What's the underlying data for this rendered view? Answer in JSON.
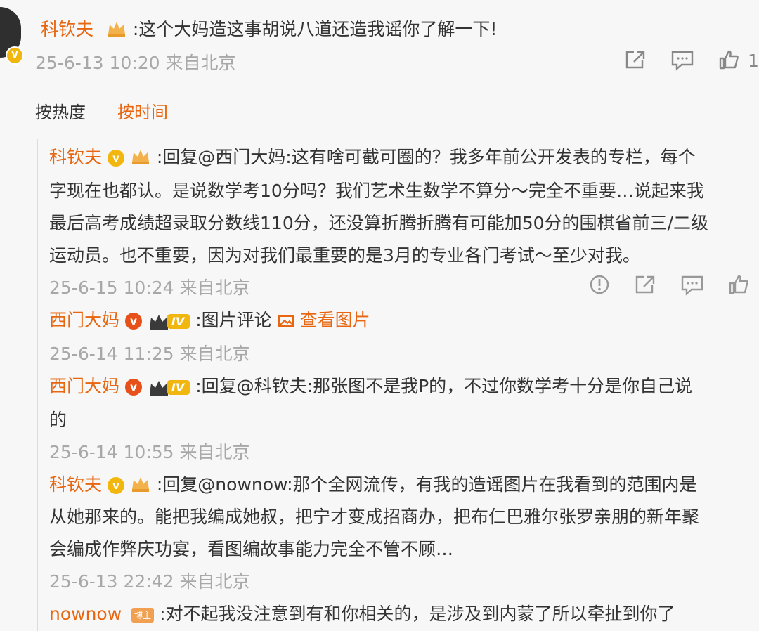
{
  "top_comment": {
    "user": "科钦夫",
    "text": ":这个大妈造这事胡说八道还造我谣你了解一下!",
    "time": "25-6-13 10:20 来自北京",
    "like_count": "1"
  },
  "sort_tabs": {
    "hot": "按热度",
    "time": "按时间"
  },
  "replies": [
    {
      "user": "科钦夫",
      "lines": [
        ":回复@西门大妈:这有啥可截可圈的？我多年前公开发表的专栏，每个",
        "字现在也都认。是说数学考10分吗？我们艺术生数学不算分～完全不重要…说起来我",
        "最后高考成绩超录取分数线110分，还没算折腾折腾有可能加50分的围棋省前三/二级",
        "运动员。也不重要，因为对我们最重要的是3月的专业各门考试～至少对我。"
      ],
      "time": "25-6-15 10:24 来自北京"
    },
    {
      "user": "西门大妈",
      "level": "IV",
      "text": ":图片评论",
      "link": "查看图片",
      "time": "25-6-14 11:25 来自北京"
    },
    {
      "user": "西门大妈",
      "level": "IV",
      "lines": [
        ":回复@科钦夫:那张图不是我P的，不过你数学考十分是你自己说",
        "的"
      ],
      "time": "25-6-14 10:55 来自北京"
    },
    {
      "user": "科钦夫",
      "lines": [
        ":回复@nownow:那个全网流传，有我的造谣图片在我看到的范围内是",
        "从她那来的。能把我编成她叔，把宁才变成招商办，把布仁巴雅尔张罗亲朋的新年聚",
        "会编成作弊庆功宴，看图编故事能力完全不管不顾…"
      ],
      "time": "25-6-13 22:42 来自北京"
    },
    {
      "user": "nownow",
      "badge": "博主",
      "text": ":对不起我没注意到有和你相关的，是涉及到内蒙了所以牵扯到你了"
    }
  ]
}
